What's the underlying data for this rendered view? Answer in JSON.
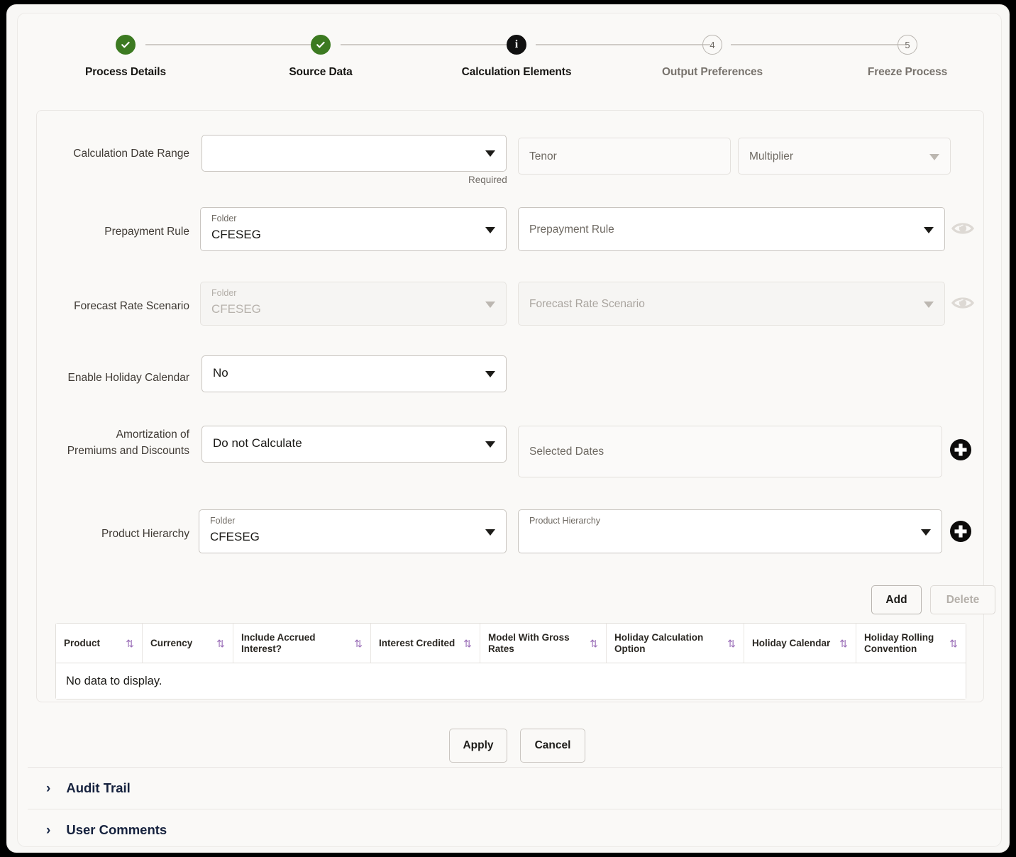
{
  "stepper": {
    "steps": [
      {
        "label": "Process Details",
        "state": "done",
        "marker": "check"
      },
      {
        "label": "Source Data",
        "state": "done",
        "marker": "check"
      },
      {
        "label": "Calculation Elements",
        "state": "current",
        "marker": "i"
      },
      {
        "label": "Output Preferences",
        "state": "pending",
        "marker": "4"
      },
      {
        "label": "Freeze Process",
        "state": "pending",
        "marker": "5"
      }
    ],
    "done_color": "#3c7a21",
    "current_color": "#111111"
  },
  "form": {
    "calculation_date_range": {
      "label": "Calculation Date Range",
      "select_value": "",
      "hint": "Required",
      "tenor_placeholder": "Tenor",
      "tenor_value": "",
      "multiplier_placeholder": "Multiplier",
      "multiplier_value": ""
    },
    "prepayment_rule": {
      "label": "Prepayment Rule",
      "folder_label": "Folder",
      "folder_value": "CFESEG",
      "rule_placeholder": "Prepayment Rule",
      "rule_value": "",
      "view_icon": "eye-icon"
    },
    "forecast_rate_scenario": {
      "label": "Forecast Rate Scenario",
      "folder_label": "Folder",
      "folder_value": "CFESEG",
      "scenario_placeholder": "Forecast Rate Scenario",
      "scenario_value": "",
      "view_icon": "eye-icon"
    },
    "enable_holiday_calendar": {
      "label": "Enable Holiday Calendar",
      "value": "No"
    },
    "amortization": {
      "label_line1": "Amortization of",
      "label_line2": "Premiums and Discounts",
      "value": "Do not Calculate",
      "selected_dates_placeholder": "Selected Dates",
      "selected_dates_value": "",
      "add_icon": "plus-circle-icon"
    },
    "product_hierarchy": {
      "label": "Product Hierarchy",
      "folder_label": "Folder",
      "folder_value": "CFESEG",
      "hierarchy_label": "Product Hierarchy",
      "hierarchy_value": "",
      "add_icon": "plus-circle-icon"
    },
    "grid_toolbar": {
      "add_label": "Add",
      "delete_label": "Delete",
      "delete_disabled": true
    }
  },
  "grid": {
    "columns": [
      "Product",
      "Currency",
      "Include Accrued Interest?",
      "Interest Credited",
      "Model With Gross Rates",
      "Holiday Calculation Option",
      "Holiday Calendar",
      "Holiday Rolling Convention"
    ],
    "rows": [],
    "empty_message": "No data to display.",
    "sort_icon": "sort-updown-icon",
    "sort_icon_color": "#9b6fb8"
  },
  "actions": {
    "apply_label": "Apply",
    "cancel_label": "Cancel"
  },
  "accordions": [
    {
      "label": "Audit Trail",
      "expanded": false,
      "chevron": "chevron-right-icon"
    },
    {
      "label": "User Comments",
      "expanded": false,
      "chevron": "chevron-right-icon"
    }
  ]
}
